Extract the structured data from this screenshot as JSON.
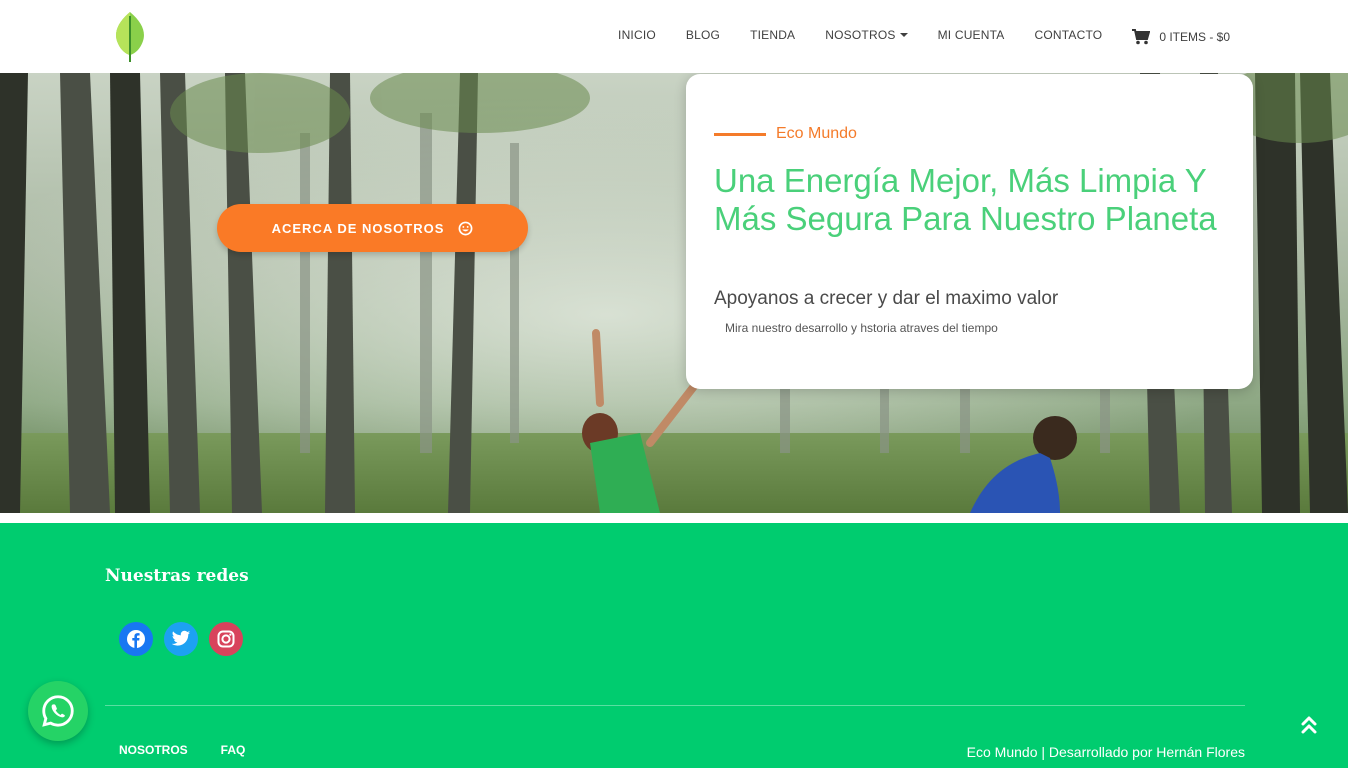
{
  "header": {
    "logo_icon": "leaf-icon",
    "nav": [
      {
        "label": "INICIO"
      },
      {
        "label": "BLOG"
      },
      {
        "label": "TIENDA"
      },
      {
        "label": "NOSOTROS",
        "has_dropdown": true
      },
      {
        "label": "MI CUENTA"
      },
      {
        "label": "CONTACTO"
      }
    ],
    "cart": {
      "icon": "cart-icon",
      "label": "0 ITEMS - $0"
    }
  },
  "hero": {
    "about_button": {
      "label": "ACERCA DE NOSOTROS",
      "icon": "smile-icon"
    },
    "card": {
      "eyebrow": "Eco Mundo",
      "title": "Una Energía Mejor, Más Limpia Y Más Segura Para Nuestro Planeta",
      "subtitle": "Apoyanos a crecer y dar el maximo valor",
      "caption": "Mira nuestro desarrollo y hstoria atraves del tiempo"
    }
  },
  "footer": {
    "heading": "Nuestras redes",
    "social": [
      {
        "icon": "facebook-icon"
      },
      {
        "icon": "twitter-icon"
      },
      {
        "icon": "instagram-icon"
      }
    ],
    "links": [
      {
        "label": "NOSOTROS"
      },
      {
        "label": "FAQ"
      }
    ],
    "credit": "Eco Mundo | Desarrollado por Hernán Flores"
  },
  "colors": {
    "brand_green": "#00cc6f",
    "accent_orange": "#fa7a26",
    "title_green": "#4ad07a"
  },
  "floating": {
    "whatsapp_icon": "whatsapp-icon",
    "back_to_top_icon": "double-chevron-up-icon"
  }
}
